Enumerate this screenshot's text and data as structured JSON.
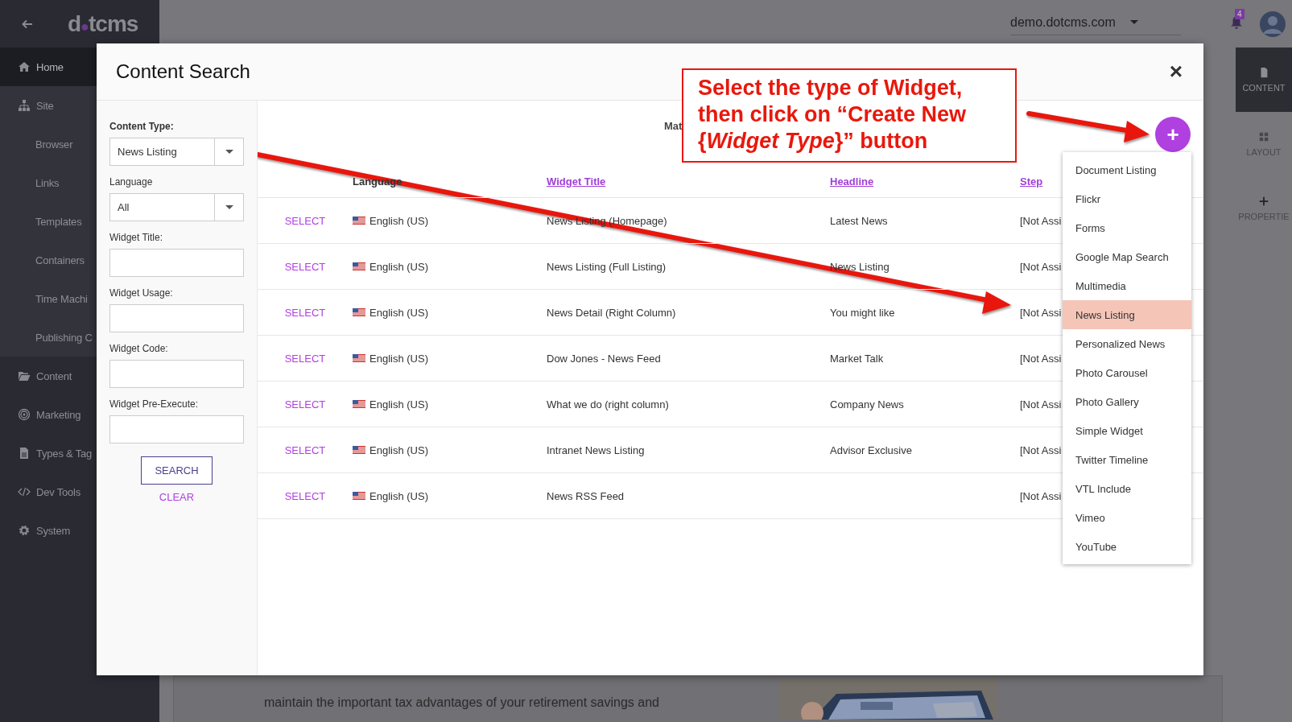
{
  "sidebar": {
    "logo": [
      "d",
      "●",
      "tcms"
    ],
    "items": [
      {
        "label": "Home",
        "selected": true
      },
      {
        "label": "Site",
        "selected": false,
        "children": [
          {
            "label": "Browser",
            "selected": false
          },
          {
            "label": "Links",
            "selected": false
          },
          {
            "label": "Templates",
            "selected": false
          },
          {
            "label": "Containers",
            "selected": false
          },
          {
            "label": "Time Machi",
            "selected": false
          },
          {
            "label": "Publishing C",
            "selected": false
          }
        ]
      },
      {
        "label": "Content",
        "selected": false
      },
      {
        "label": "Marketing",
        "selected": false
      },
      {
        "label": "Types & Tag",
        "selected": false
      },
      {
        "label": "Dev Tools",
        "selected": false
      },
      {
        "label": "System",
        "selected": false
      }
    ]
  },
  "header": {
    "site": "demo.dotcms.com",
    "notifications": "4"
  },
  "right_panel": [
    {
      "label": "CONTENT",
      "selected": true
    },
    {
      "label": "LAYOUT",
      "selected": false
    },
    {
      "label": "PROPERTIE",
      "selected": false
    }
  ],
  "background_text": "maintain the important tax advantages of your retirement savings and",
  "modal": {
    "title": "Content Search",
    "close": "×",
    "form": {
      "fields": [
        {
          "label": "Content Type:",
          "kind": "select",
          "value": "News Listing",
          "emphasized": true
        },
        {
          "label": "Language",
          "kind": "select",
          "value": "All",
          "emphasized": false
        },
        {
          "label": "Widget Title:",
          "kind": "text",
          "emphasized": false
        },
        {
          "label": "Widget Usage:",
          "kind": "text",
          "emphasized": false
        },
        {
          "label": "Widget Code:",
          "kind": "text",
          "emphasized": false
        },
        {
          "label": "Widget Pre-Execute:",
          "kind": "text",
          "emphasized": false
        }
      ],
      "buttons": [
        "SEARCH",
        "CLEAR"
      ]
    },
    "results_text": "Mat",
    "table": {
      "columns": [
        {
          "label": "Language",
          "sortable": false
        },
        {
          "label": "Widget Title",
          "sortable": true
        },
        {
          "label": "Headline",
          "sortable": true
        },
        {
          "label": "Step",
          "sortable": true
        }
      ],
      "rows": [
        {
          "action": "SELECT",
          "language": "English (US)",
          "title": "News Listing (Homepage)",
          "headline": "Latest News",
          "step": "[Not Assi"
        },
        {
          "action": "SELECT",
          "language": "English (US)",
          "title": "News Listing (Full Listing)",
          "headline": "News Listing",
          "step": "[Not Assi"
        },
        {
          "action": "SELECT",
          "language": "English (US)",
          "title": "News Detail (Right Column)",
          "headline": "You might like",
          "step": "[Not Assi"
        },
        {
          "action": "SELECT",
          "language": "English (US)",
          "title": "Dow Jones - News Feed",
          "headline": "Market Talk",
          "step": "[Not Assi"
        },
        {
          "action": "SELECT",
          "language": "English (US)",
          "title": "What we do (right column)",
          "headline": "Company News",
          "step": "[Not Assi"
        },
        {
          "action": "SELECT",
          "language": "English (US)",
          "title": "Intranet News Listing",
          "headline": "Advisor Exclusive",
          "step": "[Not Assi"
        },
        {
          "action": "SELECT",
          "language": "English (US)",
          "title": "News RSS Feed",
          "step": "[Not Assi"
        }
      ]
    },
    "add_button": "+",
    "menu": [
      {
        "label": "Document Listing",
        "selected": false
      },
      {
        "label": "Flickr",
        "selected": false
      },
      {
        "label": "Forms",
        "selected": false
      },
      {
        "label": "Google Map Search",
        "selected": false
      },
      {
        "label": "Multimedia",
        "selected": false
      },
      {
        "label": "News Listing",
        "selected": true
      },
      {
        "label": "Personalized News",
        "selected": false
      },
      {
        "label": "Photo Carousel",
        "selected": false
      },
      {
        "label": "Photo Gallery",
        "selected": false
      },
      {
        "label": "Simple Widget",
        "selected": false
      },
      {
        "label": "Twitter Timeline",
        "selected": false
      },
      {
        "label": "VTL Include",
        "selected": false
      },
      {
        "label": "Vimeo",
        "selected": false
      },
      {
        "label": "YouTube",
        "selected": false
      }
    ]
  },
  "annotation": "Select the type of Widget, then click on “Create New {*Widget Type*}” button"
}
